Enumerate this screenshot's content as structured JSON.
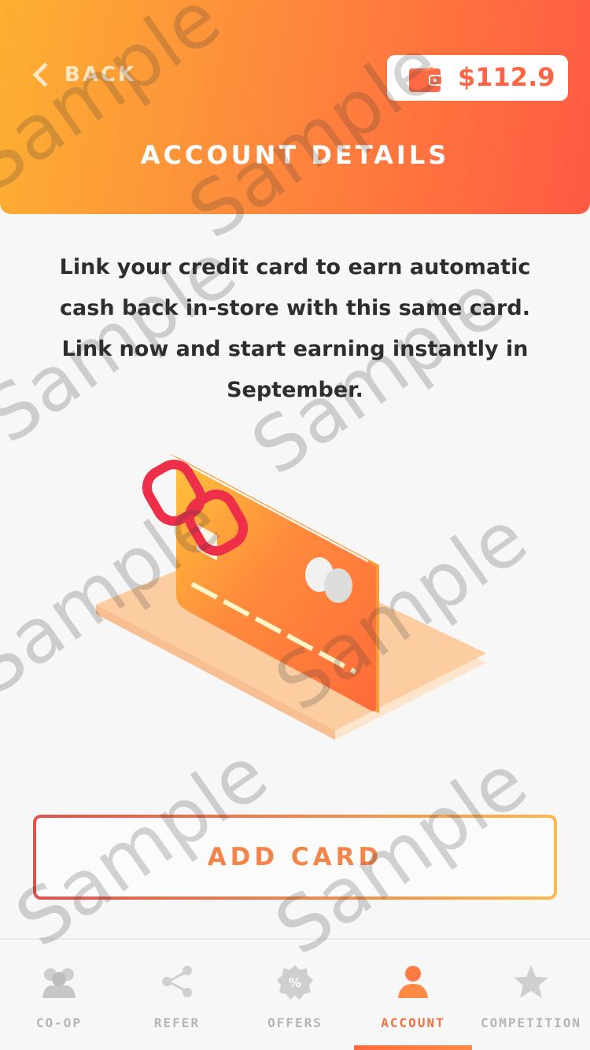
{
  "header": {
    "back_label": "BACK",
    "balance": "$112.9",
    "title": "ACCOUNT DETAILS",
    "gradient": [
      "#fdb032",
      "#ff5a44"
    ]
  },
  "main": {
    "intro_text": "Link your credit card to earn automatic cash back in-store with this same card. Link now and start earning instantly in September.",
    "illustration_icon": "credit-card-link-illustration",
    "add_card_label": "ADD CARD"
  },
  "tabs": [
    {
      "label": "CO-OP",
      "icon": "group-icon",
      "active": false
    },
    {
      "label": "REFER",
      "icon": "share-icon",
      "active": false
    },
    {
      "label": "OFFERS",
      "icon": "percent-badge-icon",
      "active": false
    },
    {
      "label": "ACCOUNT",
      "icon": "user-icon",
      "active": true
    },
    {
      "label": "COMPETITION",
      "icon": "star-icon",
      "active": false
    }
  ],
  "watermark": "Sample",
  "colors": {
    "accent": "#f0733f",
    "balance_text": "#ff6444",
    "inactive_tab": "#b5b5b5"
  }
}
